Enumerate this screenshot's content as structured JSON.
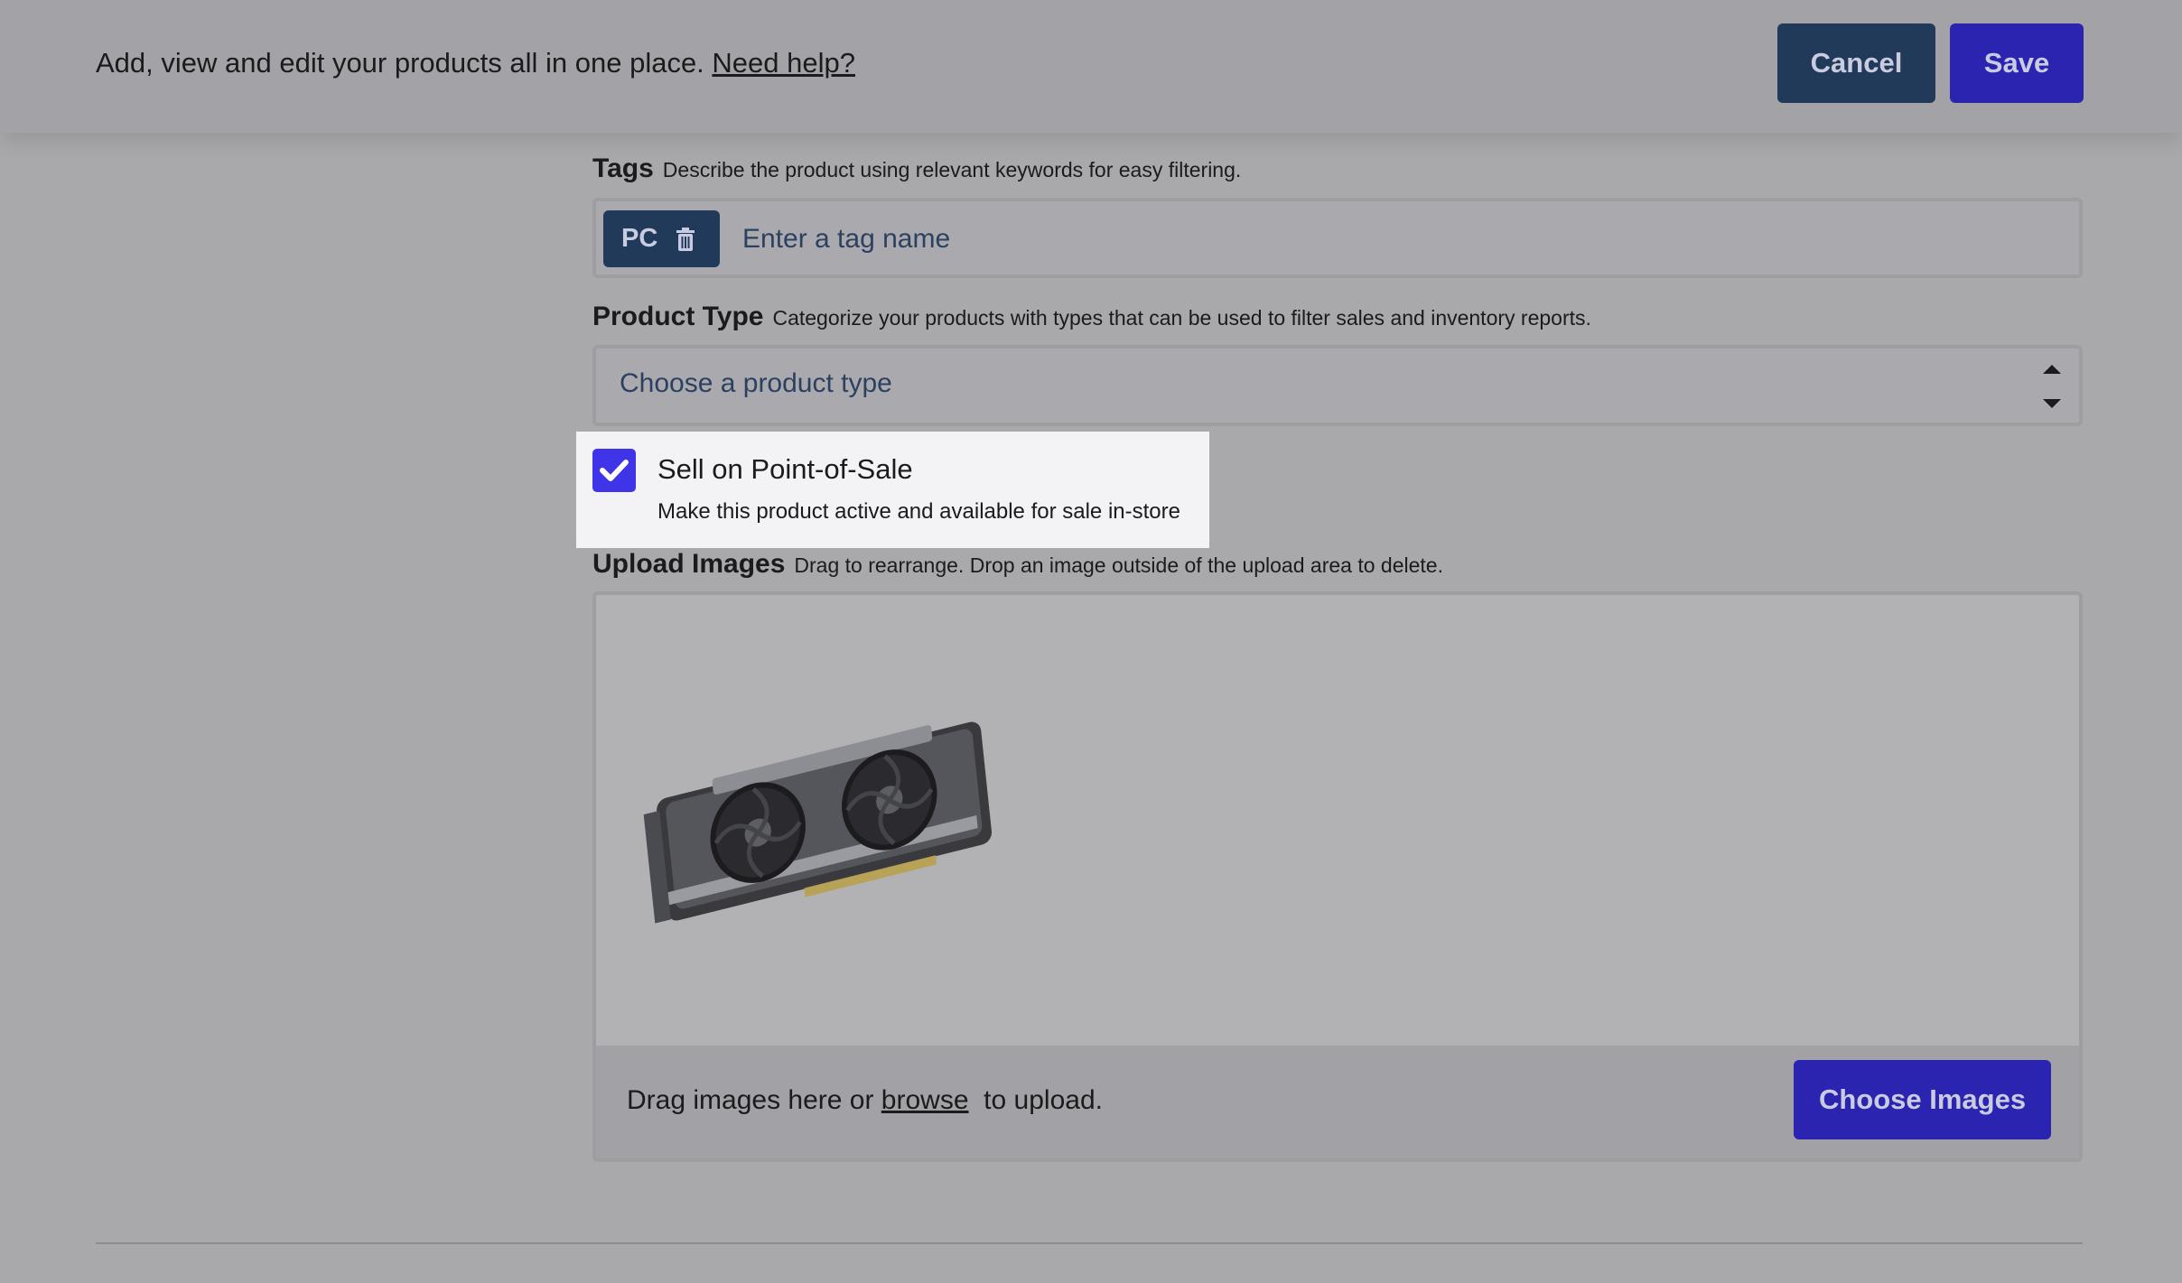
{
  "header": {
    "description": "Add, view and edit your products all in one place.",
    "help_link": "Need help?",
    "cancel_label": "Cancel",
    "save_label": "Save"
  },
  "tags": {
    "label": "Tags",
    "description": "Describe the product using relevant keywords for easy filtering.",
    "items": [
      {
        "label": "PC",
        "icon": "trash-icon"
      }
    ],
    "placeholder": "Enter a tag name"
  },
  "product_type": {
    "label": "Product Type",
    "description": "Categorize your products with types that can be used to filter sales and inventory reports.",
    "placeholder": "Choose a product type"
  },
  "pos": {
    "checked": true,
    "title": "Sell on Point-of-Sale",
    "description": "Make this product active and available for sale in-store"
  },
  "upload": {
    "label": "Upload Images",
    "description": "Drag to rearrange. Drop an image outside of the upload area to delete.",
    "hint_before": "Drag images here or ",
    "browse_link": "browse",
    "hint_after": "  to upload.",
    "choose_label": "Choose Images",
    "images": [
      {
        "alt": "graphics-card-image"
      }
    ]
  },
  "colors": {
    "primary": "#2a24b1",
    "secondary": "#223a59",
    "checkbox": "#3f34e8"
  }
}
